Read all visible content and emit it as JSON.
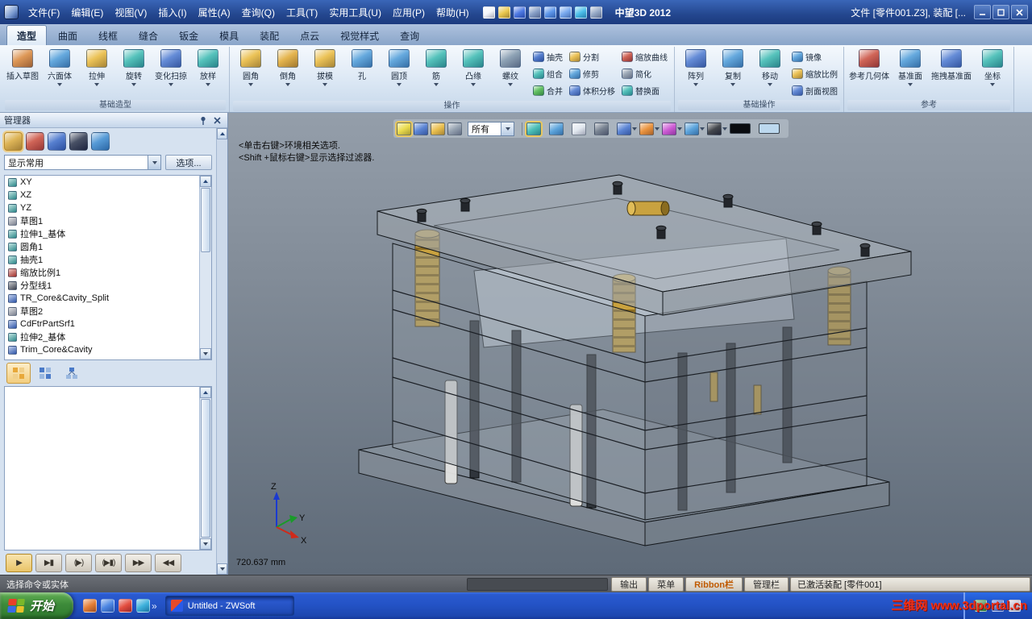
{
  "titlebar": {
    "menus": [
      "文件(F)",
      "编辑(E)",
      "视图(V)",
      "插入(I)",
      "属性(A)",
      "查询(Q)",
      "工具(T)",
      "实用工具(U)",
      "应用(P)",
      "帮助(H)"
    ],
    "tool_icons": [
      {
        "name": "new-file-icon",
        "color": "#f2f5fa"
      },
      {
        "name": "open-folder-icon",
        "color": "#e8c23a"
      },
      {
        "name": "save-icon",
        "color": "#3a6ae0"
      },
      {
        "name": "save-all-icon",
        "color": "#7a94c0"
      },
      {
        "name": "undo-icon",
        "color": "#4a8ae8"
      },
      {
        "name": "redo-icon",
        "color": "#6aa0ee"
      },
      {
        "name": "view-orient-icon",
        "color": "#38b8e8"
      },
      {
        "name": "settings-icon",
        "color": "#8aa0c0"
      }
    ],
    "app_title": "中望3D 2012",
    "doc_info": "文件 [零件001.Z3],  装配 [..."
  },
  "ribbon": {
    "tabs": [
      {
        "label": "造型",
        "active": true
      },
      {
        "label": "曲面"
      },
      {
        "label": "线框"
      },
      {
        "label": "缝合"
      },
      {
        "label": "钣金"
      },
      {
        "label": "模具"
      },
      {
        "label": "装配"
      },
      {
        "label": "点云"
      },
      {
        "label": "视觉样式"
      },
      {
        "label": "查询"
      }
    ],
    "groups": {
      "basic_shape": {
        "label": "基础造型",
        "buttons": [
          {
            "label": "插入草图",
            "color": "#d8863a"
          },
          {
            "label": "六面体",
            "color": "#4a9ad8",
            "arrow": true
          },
          {
            "label": "拉伸",
            "color": "#e8b83a",
            "arrow": true
          },
          {
            "label": "旋转",
            "color": "#38b8b0",
            "arrow": true
          },
          {
            "label": "变化扫掠",
            "color": "#4a78d0",
            "arrow": true
          },
          {
            "label": "放样",
            "color": "#38b8b0",
            "arrow": true
          }
        ]
      },
      "operation": {
        "label": "操作",
        "big": [
          {
            "label": "圆角",
            "color": "#e8b83a",
            "arrow": true
          },
          {
            "label": "倒角",
            "color": "#e0a830",
            "arrow": true
          },
          {
            "label": "拔模",
            "color": "#e8b83a",
            "arrow": true
          },
          {
            "label": "孔",
            "color": "#4a9ad8"
          },
          {
            "label": "圆顶",
            "color": "#4a9ad8",
            "arrow": true
          },
          {
            "label": "筋",
            "color": "#38b8b0",
            "arrow": true
          },
          {
            "label": "凸缘",
            "color": "#38b8b0",
            "arrow": true
          },
          {
            "label": "螺纹",
            "color": "#7a92a8",
            "arrow": true
          }
        ],
        "small": [
          {
            "label": "抽壳",
            "color": "#3a6ac8"
          },
          {
            "label": "分割",
            "color": "#e8b83a"
          },
          {
            "label": "缩放曲线",
            "color": "#c84a3a"
          },
          {
            "label": "组合",
            "color": "#38b8b0"
          },
          {
            "label": "修剪",
            "color": "#4a9ad8"
          },
          {
            "label": "简化",
            "color": "#8a98a8"
          },
          {
            "label": "合并",
            "color": "#4ab84a"
          },
          {
            "label": "体积分移",
            "color": "#4a78d0"
          },
          {
            "label": "替换面",
            "color": "#38b8b0"
          }
        ]
      },
      "basic_op": {
        "label": "基础操作",
        "big": [
          {
            "label": "阵列",
            "color": "#4a78d0",
            "arrow": true
          },
          {
            "label": "复制",
            "color": "#4a9ad8",
            "arrow": true
          },
          {
            "label": "移动",
            "color": "#38b8b0",
            "arrow": true
          }
        ],
        "small": [
          {
            "label": "镜像",
            "color": "#4a9ad8"
          },
          {
            "label": "缩放比例",
            "color": "#e8b83a"
          },
          {
            "label": "剖面视图",
            "color": "#4a78d0"
          }
        ]
      },
      "reference": {
        "label": "参考",
        "buttons": [
          {
            "label": "参考几何体",
            "color": "#c84a3a"
          },
          {
            "label": "基准面",
            "color": "#4a9ad8",
            "arrow": true
          },
          {
            "label": "拖拽基准面",
            "color": "#4a78d0"
          },
          {
            "label": "坐标",
            "color": "#38b8b0",
            "arrow": true
          }
        ]
      }
    }
  },
  "manager": {
    "title": "管理器",
    "toolbar_icons": [
      {
        "name": "history-manager-icon",
        "color": "#d8a83a",
        "active": true
      },
      {
        "name": "filter-manager-icon",
        "color": "#c84a3a"
      },
      {
        "name": "layer-manager-icon",
        "color": "#3a6ac8"
      },
      {
        "name": "visibility-manager-icon",
        "color": "#28324a"
      },
      {
        "name": "search-manager-icon",
        "color": "#3a8ad0"
      }
    ],
    "filter_dropdown": "显示常用",
    "options_button": "选项...",
    "tree": [
      {
        "label": "XY",
        "color": "#35a8a0"
      },
      {
        "label": "XZ",
        "color": "#35a8a0"
      },
      {
        "label": "YZ",
        "color": "#35a8a0"
      },
      {
        "label": "草图1",
        "color": "#9aa0a8"
      },
      {
        "label": "拉伸1_基体",
        "color": "#35a8a0"
      },
      {
        "label": "圆角1",
        "color": "#35a8a0"
      },
      {
        "label": "抽壳1",
        "color": "#35a8a0"
      },
      {
        "label": "缩放比例1",
        "color": "#c83a2a"
      },
      {
        "label": "分型线1",
        "color": "#4a5058"
      },
      {
        "label": "TR_Core&Cavity_Split",
        "color": "#3a6ac8"
      },
      {
        "label": "草图2",
        "color": "#9aa0a8"
      },
      {
        "label": "CdFtrPartSrf1",
        "color": "#3a6ac8"
      },
      {
        "label": "拉伸2_基体",
        "color": "#35a8a0"
      },
      {
        "label": "Trim_Core&Cavity",
        "color": "#3a6ac8"
      }
    ],
    "playback": [
      {
        "name": "play-button",
        "glyph": "▶",
        "active": true
      },
      {
        "name": "play-to-end-button",
        "glyph": "▶▮"
      },
      {
        "name": "step-play-button",
        "glyph": "(▶)"
      },
      {
        "name": "step-to-end-button",
        "glyph": "(▶▮)"
      },
      {
        "name": "fast-forward-button",
        "glyph": "▶▶"
      },
      {
        "name": "rewind-button",
        "glyph": "◀◀"
      }
    ]
  },
  "viewport": {
    "hint_line1": "<单击右键>环境相关选项.",
    "hint_line2": "<Shift +鼠标右键>显示选择过滤器.",
    "scale_readout": "720.637 mm",
    "axis_labels": {
      "x": "X",
      "y": "Y",
      "z": "Z"
    },
    "toolbar": {
      "left_icons": [
        {
          "name": "select-tool-icon",
          "color": "#e8d83a",
          "selected": true
        },
        {
          "name": "edit-sketch-icon",
          "color": "#4a78d0"
        },
        {
          "name": "cube-tool-icon",
          "color": "#e8b83a"
        },
        {
          "name": "list-tool-icon",
          "color": "#8a98a8"
        }
      ],
      "filter_combo": "所有",
      "right_icons": [
        {
          "name": "shaded-display-icon",
          "color": "#38b8b0",
          "selected": true
        },
        {
          "name": "shaded-edges-icon",
          "color": "#4a9ad8"
        },
        {
          "name": "hidden-line-icon",
          "color": "#dfe6ee"
        },
        {
          "name": "wireframe-icon",
          "color": "#6a7686"
        },
        {
          "name": "display-mode-icon",
          "color": "#4a78d0",
          "arrow": true
        },
        {
          "name": "render-mode-icon",
          "color": "#e8882a",
          "arrow": true
        },
        {
          "name": "color-palette-icon",
          "color": "#c84ad0",
          "arrow": true
        },
        {
          "name": "grid-display-icon",
          "color": "#4a9ad8",
          "arrow": true
        },
        {
          "name": "background-icon",
          "color": "#30343a",
          "arrow": true
        },
        {
          "name": "black-color-swatch",
          "color": "#0a0c10",
          "swatch": true
        },
        {
          "name": "blue-color-swatch",
          "color": "#bcd8ee",
          "swatch": true
        }
      ]
    }
  },
  "statusbar": {
    "prompt": "选择命令或实体",
    "buttons": [
      {
        "label": "输出"
      },
      {
        "label": "菜单"
      },
      {
        "label": "Ribbon栏",
        "accent": true
      },
      {
        "label": "管理栏"
      }
    ],
    "message": "已激活装配 [零件001]"
  },
  "taskbar": {
    "start_label": "开始",
    "quick_launch": [
      {
        "name": "quick-launch-app-icon",
        "color": "#e07020"
      },
      {
        "name": "quick-launch-browser-icon",
        "color": "#3a7ae0"
      },
      {
        "name": "quick-launch-firefox-icon",
        "color": "#e03a2a"
      },
      {
        "name": "quick-launch-media-icon",
        "color": "#28a8d8"
      }
    ],
    "more_glyph": "»",
    "task_button": "Untitled - ZWSoft",
    "tray_icons": [
      {
        "name": "tray-shield-icon",
        "color": "#2a9a3a"
      },
      {
        "name": "tray-network-icon",
        "color": "#3a6ae0"
      },
      {
        "name": "tray-update-icon",
        "color": "#d8d8e8"
      }
    ],
    "watermark": "三维网 www.3dportal.cn"
  }
}
